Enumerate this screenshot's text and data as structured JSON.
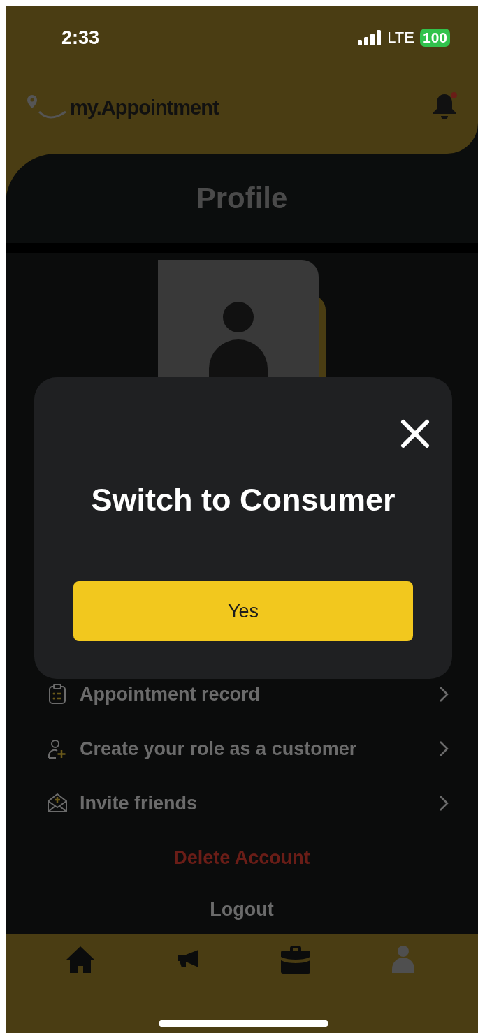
{
  "status_bar": {
    "time": "2:33",
    "network": "LTE",
    "battery": "100"
  },
  "header": {
    "logo": "my.Appointment",
    "notification_dot": true
  },
  "title": "Profile",
  "menu": [
    {
      "kind": "record",
      "label": "Appointment record"
    },
    {
      "kind": "role",
      "label": "Create your role as a customer"
    },
    {
      "kind": "invite",
      "label": "Invite friends"
    }
  ],
  "delete_label": "Delete Account",
  "logout_label": "Logout",
  "dialog": {
    "title": "Switch to Consumer",
    "confirm": "Yes"
  },
  "tabs": [
    {
      "kind": "home",
      "selected": false
    },
    {
      "kind": "announce",
      "selected": false
    },
    {
      "kind": "work",
      "selected": false
    },
    {
      "kind": "profile",
      "selected": true
    }
  ]
}
